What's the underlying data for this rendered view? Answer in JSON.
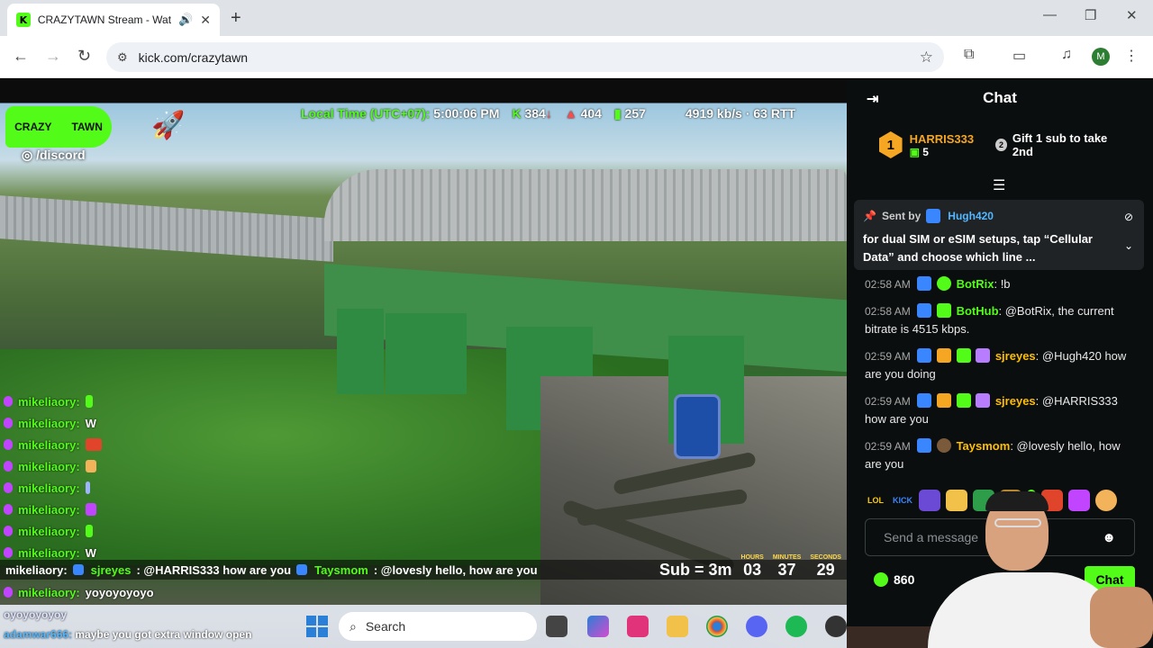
{
  "browser": {
    "tab_title": "CRAZYTAWN Stream - Watc",
    "url": "kick.com/crazytawn",
    "profile_initial": "M"
  },
  "overlay": {
    "logo_left": "CRAZY",
    "logo_right": "TAWN",
    "discord": "/discord",
    "local_time_label": "Local Time (UTC+07):",
    "local_time": "5:00:06 PM",
    "viewers_up": "384",
    "viewers_down": "404",
    "stat3": "257",
    "bitrate": "4919 kb/s · 63 RTT",
    "feed": [
      {
        "name": "mikeliaory:",
        "msg": "",
        "emote": "#53fc18"
      },
      {
        "name": "mikeliaory:",
        "msg": "W",
        "emote": ""
      },
      {
        "name": "mikeliaory:",
        "msg": "",
        "emote": "#e0442a"
      },
      {
        "name": "mikeliaory:",
        "msg": "",
        "emote": "#f2b35a"
      },
      {
        "name": "mikeliaory:",
        "msg": "",
        "emote": "#9fb4ff"
      },
      {
        "name": "mikeliaory:",
        "msg": "",
        "emote": "#c145ff"
      },
      {
        "name": "mikeliaory:",
        "msg": "",
        "emote": "#53fc18"
      },
      {
        "name": "mikeliaory:",
        "msg": "W",
        "emote": ""
      }
    ],
    "feed_last_name": "mikeliaory:",
    "feed_last_msg": "yoyoyoyoyo",
    "feed_faded_msg": "oyoyoyoyoy",
    "bottom_chat_name": "adamwar666:",
    "bottom_chat_msg": "maybe you got extra window open",
    "ticker": {
      "prefix": "mikeliaory: ",
      "u1": "sjreyes",
      "m1": ": @HARRIS333 how are you",
      "u2": "Taysmom",
      "m2": ": @lovesly hello, how are you"
    },
    "countdown": {
      "sub_label": "Sub = 3m",
      "hours_label": "HOURS",
      "hours": "03",
      "minutes_label": "MINUTES",
      "minutes": "37",
      "seconds_label": "SECONDS",
      "seconds": "29"
    }
  },
  "taskbar": {
    "search_label": "Search"
  },
  "chat": {
    "title": "Chat",
    "leader": {
      "rank": "1",
      "name": "HARRIS333",
      "count": "5"
    },
    "gift_num": "2",
    "gift_text": "Gift 1 sub to take 2nd",
    "pinned": {
      "sent_by": "Sent by",
      "user": "Hugh420",
      "text": "for dual SIM or eSIM setups, tap “Cellular Data” and choose which line ..."
    },
    "messages": [
      {
        "time": "02:58 AM",
        "user": "BotRix",
        "text": ": !b"
      },
      {
        "time": "02:58 AM",
        "user": "BotHub",
        "text": ": @BotRix, the current bitrate is 4515 kbps."
      },
      {
        "time": "02:59 AM",
        "user": "sjreyes",
        "text": ": @Hugh420 how are you doing"
      },
      {
        "time": "02:59 AM",
        "user": "sjreyes",
        "text": ": @HARRIS333 how are you"
      },
      {
        "time": "02:59 AM",
        "user": "Taysmom",
        "text": ": @lovesly hello, how are you"
      }
    ],
    "emotes": [
      "LOL",
      "KICK"
    ],
    "input_placeholder": "Send a message",
    "points": "860",
    "send_label": "Chat"
  }
}
